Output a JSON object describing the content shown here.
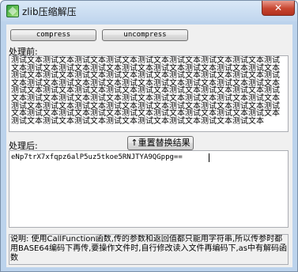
{
  "window": {
    "title": "zlib压缩解压",
    "close_label": "✕"
  },
  "toolbar": {
    "compress_label": "compress",
    "uncompress_label": "uncompress"
  },
  "before": {
    "label": "处理前:",
    "text": "测试文本测试文本测试文本测试文本测试文本测试文本测试文本测试文本测试文本测试文本测试文本测试文本测试文本测试文本测试文本测试文本测试文本测试文本测试文本测试文本测试文本测试文本测试文本测试文本测试文本测试文本测试文本测试文本测试文本测试文本测试文本测试文本测试文本测试文本测试文本测试文本测试文本测试文本测试文本测试文本测试文本测试文本测试文本测试文本测试文本测试文本测试文本测试文本测试文本测试文本测试文本测试文本测试文本测试文本测试文本测试文本测试文本测试文本测试文本测试文本测试文本测试文本测试文本测试文本测试文本测试文本测试文本测试文本测试文本测试文本测试文本测试文本测试文本测试文本测试文本测试文本"
  },
  "reset": {
    "label": "↑重置替换结果"
  },
  "after": {
    "label": "处理后:",
    "text": "eNp7trX7xfqpz6alP5uz5tkoe5RNJTYA9QGppg=="
  },
  "note": {
    "text": "说明: 使用CallFunction函数,传的参数和返回值都只能用字符串,所以传参时都用BASE64编码下再传,要操作文件时,自行修改读入文件再编码下,as中有解码函数"
  }
}
